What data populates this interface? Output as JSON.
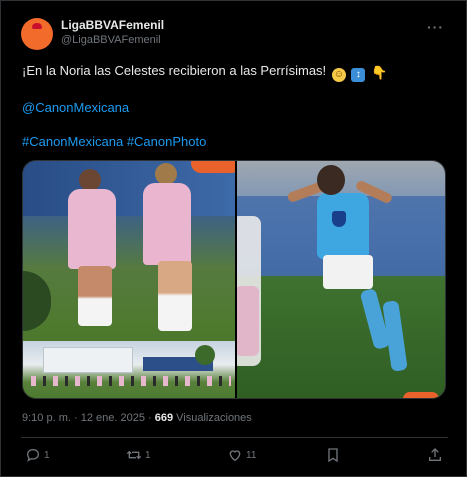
{
  "account": {
    "display_name": "LigaBBVAFemenil",
    "handle": "@LigaBBVAFemenil",
    "avatar_text": "Liga MX"
  },
  "tweet": {
    "line1": "¡En la Noria las Celestes recibieron a las Perrísimas!",
    "emojis": [
      "smile-emoji",
      "up-down-arrow-emoji",
      "pointing-down-emoji"
    ],
    "mention": "@CanonMexicana",
    "hashtag1": "#CanonMexicana",
    "hashtag2": "#CanonPhoto"
  },
  "media": {
    "left_image": "two-players-celebrating-photo",
    "right_image": "player-celebrating-photo"
  },
  "meta": {
    "time": "9:10 p. m.",
    "separator": "·",
    "date": "12 ene. 2025",
    "views_count": "669",
    "views_label": "Visualizaciones"
  },
  "actions": {
    "reply_count": "1",
    "retweet_count": "1",
    "like_count": "11",
    "bookmark_count": "",
    "share_count": ""
  },
  "colors": {
    "background": "#000000",
    "text": "#e7e9ea",
    "muted": "#71767b",
    "link": "#1d9bf0",
    "border": "#2f3336",
    "avatar": "#f26b2a"
  }
}
